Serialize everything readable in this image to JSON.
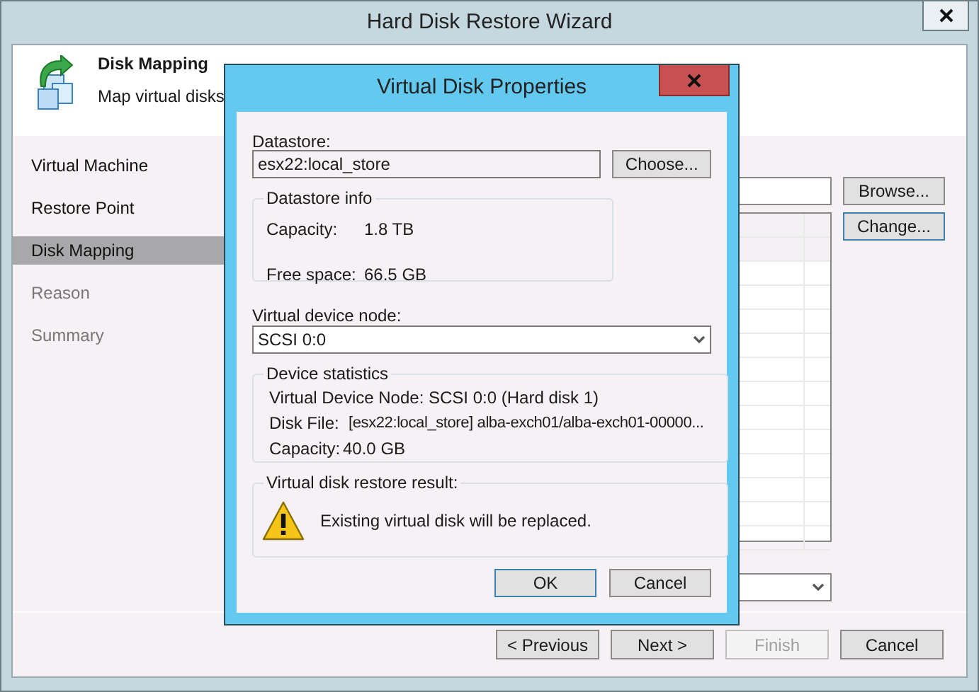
{
  "window": {
    "title": "Hard Disk Restore Wizard"
  },
  "header": {
    "title": "Disk Mapping",
    "subtitle": "Map virtual disks"
  },
  "steps": [
    {
      "label": "Virtual Machine",
      "selected": false,
      "disabled": false
    },
    {
      "label": "Restore Point",
      "selected": false,
      "disabled": false
    },
    {
      "label": "Disk Mapping",
      "selected": true,
      "disabled": false
    },
    {
      "label": "Reason",
      "selected": false,
      "disabled": true
    },
    {
      "label": "Summary",
      "selected": false,
      "disabled": true
    }
  ],
  "side_buttons": [
    {
      "label": "Browse...",
      "focused": false
    },
    {
      "label": "Change...",
      "focused": true
    }
  ],
  "footer_buttons": [
    {
      "label": "< Previous",
      "disabled": false
    },
    {
      "label": "Next >",
      "disabled": false
    },
    {
      "label": "Finish",
      "disabled": true
    },
    {
      "label": "Cancel",
      "disabled": false
    }
  ],
  "dialog": {
    "title": "Virtual Disk Properties",
    "datastore_label": "Datastore:",
    "datastore_value": "esx22:local_store",
    "choose_button": "Choose...",
    "datastore_info": {
      "legend": "Datastore info",
      "rows": [
        {
          "label": "Capacity:",
          "value": "1.8 TB"
        },
        {
          "label": "Free space:",
          "value": "66.5 GB"
        }
      ]
    },
    "node_label": "Virtual device node:",
    "node_value": "SCSI 0:0",
    "device_statistics": {
      "legend": "Device statistics",
      "node_line": "Virtual Device Node: SCSI 0:0 (Hard disk 1)",
      "rows": [
        {
          "label": "Disk File:",
          "value": "[esx22:local_store] alba-exch01/alba-exch01-00000..."
        },
        {
          "label": "Capacity:",
          "value": "40.0 GB"
        }
      ]
    },
    "result": {
      "legend": "Virtual disk restore result:",
      "message": "Existing virtual disk will be replaced."
    },
    "buttons": [
      {
        "label": "OK",
        "default": true
      },
      {
        "label": "Cancel",
        "default": false
      }
    ]
  }
}
